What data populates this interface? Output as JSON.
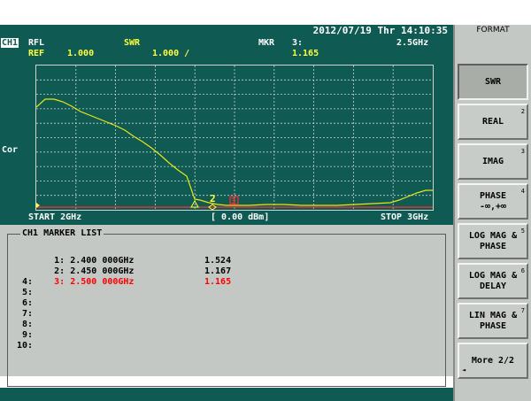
{
  "datetime": "2012/07/19 Thr 14:10:35",
  "header": {
    "channel": "CH1",
    "meas": "RFL",
    "format": "SWR",
    "ref_label": "REF",
    "ref_value": "1.000",
    "scale": "1.000 /",
    "mkr_label": "MKR",
    "mkr_num": "3:",
    "mkr_freq": "2.5GHz",
    "mkr_value": "1.165"
  },
  "graph": {
    "cor": "Cor",
    "start": "START 2GHz",
    "power": "[ 0.00 dBm]",
    "stop": "STOP 3GHz",
    "trace_color": "#e8e814",
    "marker_color": "#ffff3c",
    "active_marker_color": "#ff3030"
  },
  "marker_list": {
    "title": "CH1 MARKER LIST",
    "rows": [
      {
        "label": "1:",
        "freq": "2.400 000GHz",
        "value": "1.524"
      },
      {
        "label": "2:",
        "freq": "2.450 000GHz",
        "value": "1.167"
      },
      {
        "label": "3:",
        "freq": "2.500 000GHz",
        "value": "1.165"
      },
      {
        "label": "4:",
        "freq": "",
        "value": ""
      },
      {
        "label": "5:",
        "freq": "",
        "value": ""
      },
      {
        "label": "6:",
        "freq": "",
        "value": ""
      },
      {
        "label": "7:",
        "freq": "",
        "value": ""
      },
      {
        "label": "8:",
        "freq": "",
        "value": ""
      },
      {
        "label": "9:",
        "freq": "",
        "value": ""
      },
      {
        "label": "10:",
        "freq": "",
        "value": ""
      }
    ]
  },
  "softkeys": {
    "title": "FORMAT",
    "keys": [
      {
        "line1": "SWR",
        "line2": "",
        "num": ""
      },
      {
        "line1": "REAL",
        "line2": "",
        "num": "2"
      },
      {
        "line1": "IMAG",
        "line2": "",
        "num": "3"
      },
      {
        "line1": "PHASE",
        "line2": "-∞,+∞",
        "num": "4"
      },
      {
        "line1": "LOG MAG &",
        "line2": "PHASE",
        "num": "5"
      },
      {
        "line1": "LOG MAG &",
        "line2": "DELAY",
        "num": "6"
      },
      {
        "line1": "LIN MAG &",
        "line2": "PHASE",
        "num": "7"
      },
      {
        "line1": "More 2/2",
        "line2": "",
        "num": ""
      }
    ]
  }
}
